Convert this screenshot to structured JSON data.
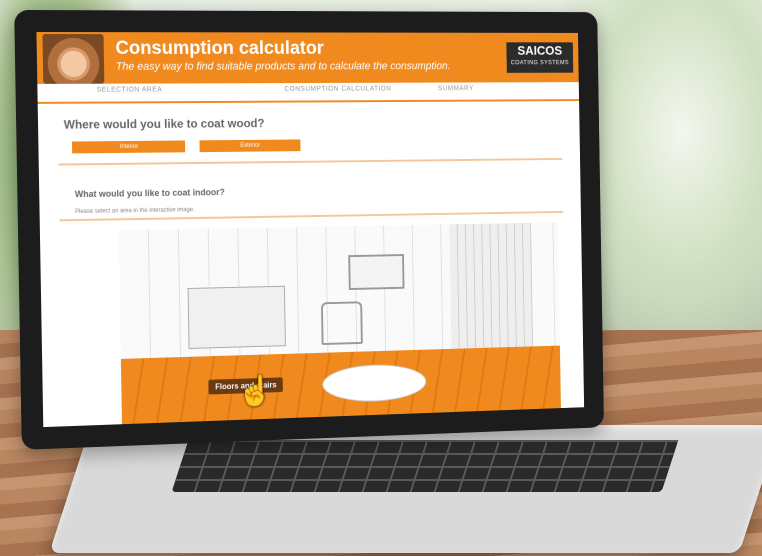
{
  "app": {
    "title": "Consumption calculator",
    "subtitle": "The easy way to find suitable products and to calculate the consumption.",
    "logo_text": "SAICOS",
    "logo_tagline": "COATING SYSTEMS"
  },
  "tabs": [
    {
      "label": "SELECTION AREA"
    },
    {
      "label": "CONSUMPTION CALCULATION"
    },
    {
      "label": "SUMMARY"
    }
  ],
  "question1": {
    "text": "Where would you like to coat wood?",
    "options": [
      "Interior",
      "Exterior"
    ]
  },
  "question2": {
    "text": "What would you like to coat indoor?",
    "hint": "Please select an area in the interactive image."
  },
  "scene": {
    "tooltip": "Floors and stairs"
  },
  "colors": {
    "accent": "#f08a1e",
    "logo_bg": "#2b2b2b"
  }
}
